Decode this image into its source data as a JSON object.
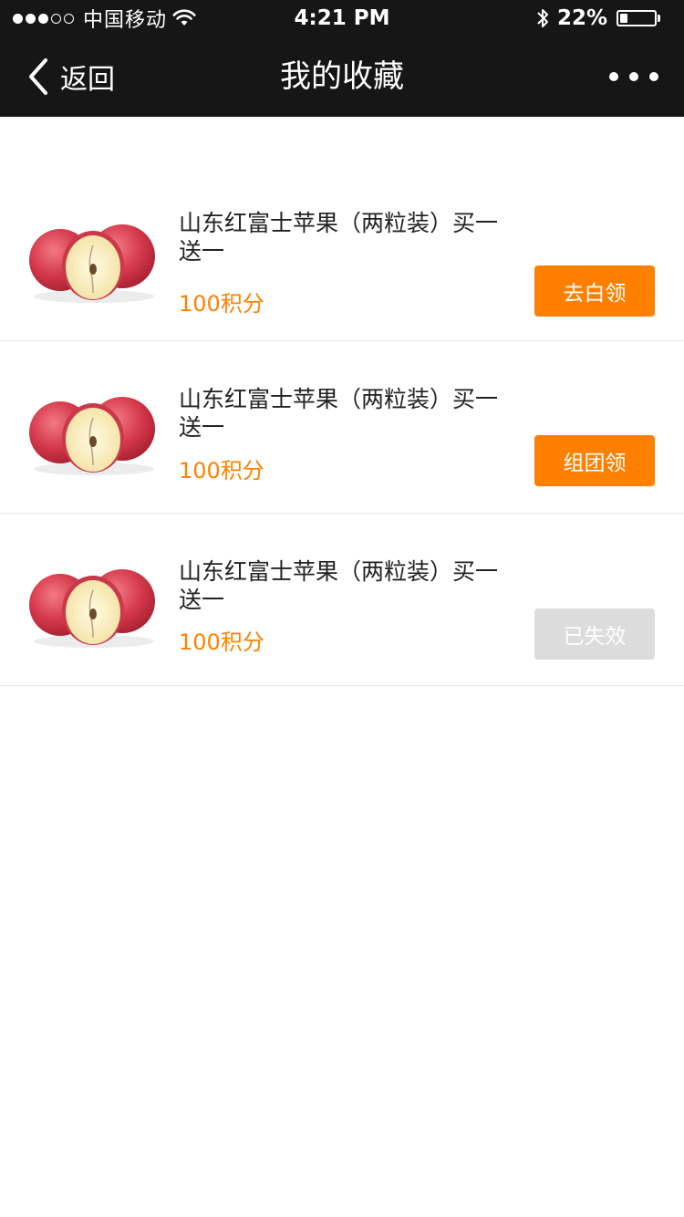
{
  "status_bar": {
    "carrier": "中国移动",
    "time": "4:21 PM",
    "battery_text": "22%",
    "battery_level": 0.22,
    "signal_bars_filled": 3,
    "signal_bars_total": 5
  },
  "nav": {
    "back_label": "返回",
    "title": "我的收藏",
    "back_icon": "chevron-left-icon",
    "more_icon": "more-dots-icon"
  },
  "items": [
    {
      "title": "山东红富士苹果（两粒装）买一送一",
      "points": "100积分",
      "action": "去白领",
      "action_state": "active"
    },
    {
      "title": "山东红富士苹果（两粒装）买一送一",
      "points": "100积分",
      "action": "组团领",
      "action_state": "active"
    },
    {
      "title": "山东红富士苹果（两粒装）买一送一",
      "points": "100积分",
      "action": "已失效",
      "action_state": "disabled"
    }
  ],
  "colors": {
    "header_bg": "#161616",
    "accent": "#ff8000",
    "points_text": "#ff8200",
    "disabled_button": "#dcdcdc"
  }
}
